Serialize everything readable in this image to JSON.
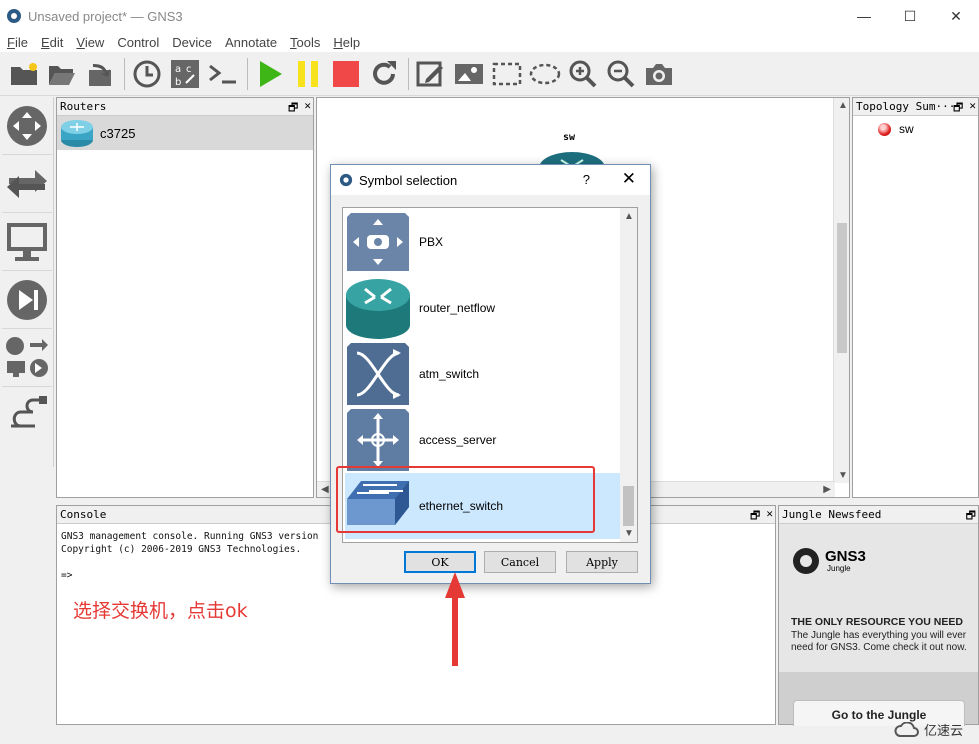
{
  "window": {
    "title": "Unsaved project* — GNS3",
    "minimize": "—",
    "maximize": "☐",
    "close": "✕"
  },
  "menu": [
    {
      "label": "File",
      "accel": "F",
      "rest": "ile"
    },
    {
      "label": "Edit",
      "accel": "E",
      "rest": "dit"
    },
    {
      "label": "View",
      "accel": "V",
      "rest": "iew"
    },
    {
      "label": "Control",
      "accel": "",
      "rest": "Control"
    },
    {
      "label": "Device",
      "accel": "",
      "rest": "Device"
    },
    {
      "label": "Annotate",
      "accel": "",
      "rest": "Annotate"
    },
    {
      "label": "Tools",
      "accel": "T",
      "rest": "ools"
    },
    {
      "label": "Help",
      "accel": "H",
      "rest": "elp"
    }
  ],
  "routers_dock": {
    "title": "Routers",
    "items": [
      {
        "label": "c3725"
      }
    ]
  },
  "canvas": {
    "node_label": "sw"
  },
  "topology_dock": {
    "title": "Topology Sum···",
    "items": [
      {
        "label": "sw",
        "status_color": "#e02020"
      }
    ]
  },
  "console_dock": {
    "title": "Console",
    "lines": "GNS3 management console. Running GNS3 version\nCopyright (c) 2006-2019 GNS3 Technologies.\n\n=>"
  },
  "annotation": {
    "text": "选择交换机，点击ok",
    "color": "#e53935"
  },
  "jungle_dock": {
    "title": "Jungle Newsfeed",
    "logo_word": "GNS3",
    "logo_sub": "Jungle",
    "headline": "THE ONLY RESOURCE YOU NEED",
    "text": "The Jungle has everything you will ever need for GNS3. Come check it out now.",
    "button": "Go to the Jungle"
  },
  "dialog": {
    "title": "Symbol selection",
    "help": "?",
    "close": "✕",
    "symbols": [
      {
        "label": "PBX",
        "icon": "pbx-icon"
      },
      {
        "label": "router_netflow",
        "icon": "router-netflow-icon"
      },
      {
        "label": "atm_switch",
        "icon": "atm-switch-icon"
      },
      {
        "label": "access_server",
        "icon": "access-server-icon"
      },
      {
        "label": "ethernet_switch",
        "icon": "ethernet-switch-icon"
      }
    ],
    "selected": "ethernet_switch",
    "buttons": {
      "ok": "OK",
      "cancel": "Cancel",
      "apply": "Apply"
    }
  },
  "watermark": {
    "text": "亿速云"
  }
}
